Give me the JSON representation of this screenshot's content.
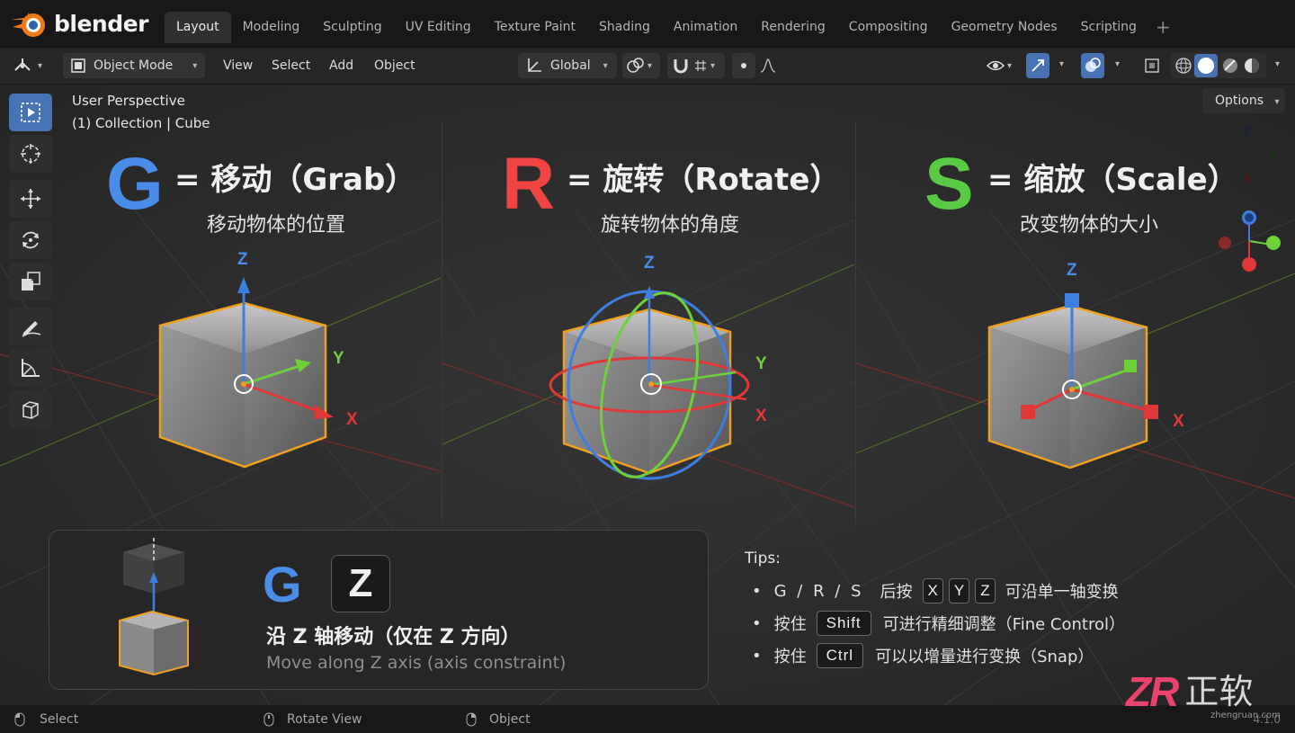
{
  "app": {
    "logo_text": "blender",
    "version": "4.1.0"
  },
  "workspace_tabs": [
    "Layout",
    "Modeling",
    "Sculpting",
    "UV Editing",
    "Texture Paint",
    "Shading",
    "Animation",
    "Rendering",
    "Compositing",
    "Geometry Nodes",
    "Scripting"
  ],
  "active_tab": "Layout",
  "header": {
    "mode": "Object Mode",
    "menus": [
      "View",
      "Select",
      "Add",
      "Object"
    ],
    "transform_orientation": "Global"
  },
  "viewport": {
    "view_name": "User Perspective",
    "collection_info": "(1) Collection | Cube",
    "options_label": "Options",
    "gizmo_labels": {
      "z": "Z",
      "y": "Y",
      "x": "X"
    }
  },
  "panels": [
    {
      "letter": "G",
      "title": "= 移动（Grab）",
      "subtitle": "移动物体的位置",
      "color": "#4a8de8",
      "axes": {
        "z": "Z",
        "y": "Y",
        "x": "X"
      }
    },
    {
      "letter": "R",
      "title": "= 旋转（Rotate）",
      "subtitle": "旋转物体的角度",
      "color": "#ee4444",
      "axes": {
        "z": "Z",
        "y": "Y",
        "x": "X"
      }
    },
    {
      "letter": "S",
      "title": "= 缩放（Scale）",
      "subtitle": "改变物体的大小",
      "color": "#5ac946",
      "axes": {
        "z": "Z",
        "y": "Y",
        "x": "X"
      }
    }
  ],
  "callout": {
    "letter": "G",
    "key": "Z",
    "text_zh": "沿 Z 轴移动（仅在 Z 方向）",
    "text_en": "Move along Z axis (axis constraint)"
  },
  "tips": {
    "title": "Tips:",
    "t1_prefix": "G / R / S",
    "t1_mid": "后按",
    "t1_keys": [
      "X",
      "Y",
      "Z"
    ],
    "t1_suffix": "可沿单一轴变换",
    "t2_prefix": "按住",
    "t2_key": "Shift",
    "t2_suffix": "可进行精细调整（Fine Control）",
    "t3_prefix": "按住",
    "t3_key": "Ctrl",
    "t3_suffix": "可以以增量进行变换（Snap）"
  },
  "statusbar": {
    "items": [
      "Select",
      "Rotate View",
      "Object"
    ]
  },
  "watermark": {
    "mark": "ZR",
    "cn": "正软",
    "url": "zhengruan.com"
  }
}
